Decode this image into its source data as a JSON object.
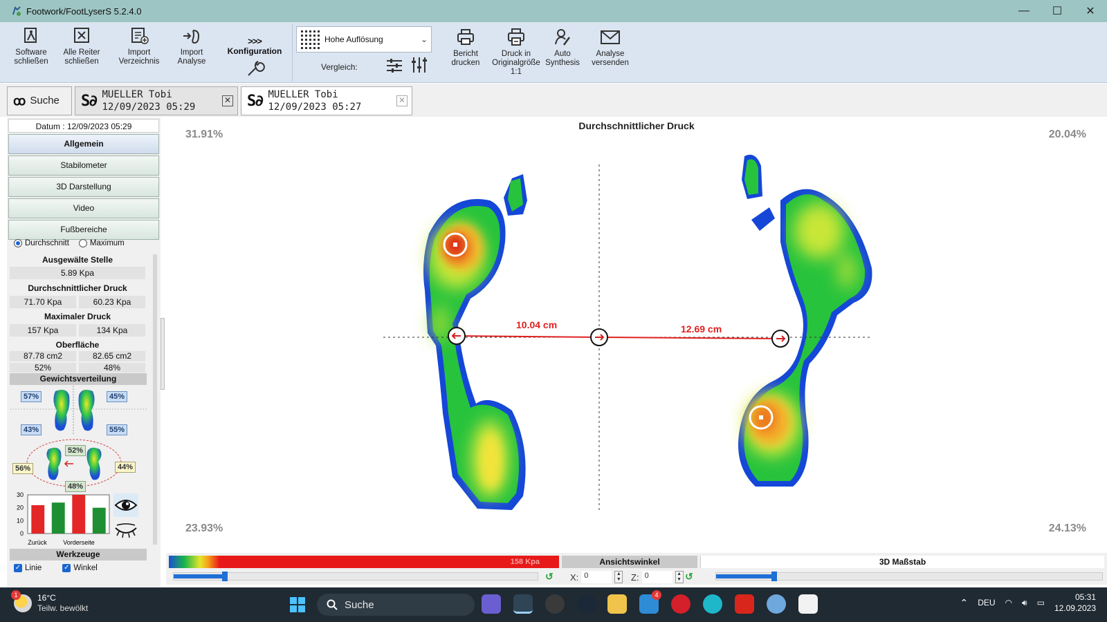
{
  "window": {
    "title": "Footwork/FootLyserS 5.2.4.0",
    "minimize": "—",
    "maximize": "☐",
    "close": "✕"
  },
  "ribbon": {
    "software_schliessen": "Software\nschließen",
    "alle_reiter_schliessen": "Alle Reiter\nschließen",
    "import_verzeichnis": "Import\nVerzeichnis",
    "import_analyse": "Import\nAnalyse",
    "konfiguration_arrows": ">>>",
    "konfiguration": "Konfiguration",
    "resolution_value": "Hohe Auflösung",
    "vergleich": "Vergleich:",
    "bericht_drucken": "Bericht\ndrucken",
    "druck_original": "Druck in\nOriginalgröße\n1:1",
    "auto_synthesis": "Auto\nSynthesis",
    "analyse_versenden": "Analyse\nversenden"
  },
  "tabs": {
    "search_label": "Suche",
    "tab1": {
      "name": "MUELLER Tobi",
      "date": "12/09/2023 05:29"
    },
    "tab2": {
      "name": "MUELLER Tobi",
      "date": "12/09/2023 05:27"
    }
  },
  "left": {
    "datum": "Datum : 12/09/2023 05:29",
    "nav": [
      "Allgemein",
      "Stabilometer",
      "3D Darstellung",
      "Video",
      "Fußbereiche"
    ],
    "radio_avg": "Durchschnitt",
    "radio_max": "Maximum",
    "ausgewaehlte_stelle": "Ausgewälte Stelle",
    "stelle_value": "5.89 Kpa",
    "durchschn_druck": "Durchschnittlicher Druck",
    "durchschn_left": "71.70 Kpa",
    "durchschn_right": "60.23 Kpa",
    "max_druck": "Maximaler Druck",
    "max_left": "157 Kpa",
    "max_right": "134 Kpa",
    "oberflaeche": "Oberfläche",
    "ober_left": "87.78 cm2",
    "ober_right": "82.65 cm2",
    "ober_pct_left": "52%",
    "ober_pct_right": "48%",
    "gewichtsverteilung": "Gewichtsverteilung",
    "gw": {
      "top_left": "57%",
      "top_right": "45%",
      "bottom_left": "43%",
      "bottom_right": "55%",
      "center_top": "52%",
      "center_bottom": "48%",
      "side_left": "56%",
      "side_right": "44%"
    },
    "bar_chart": {
      "y_ticks": [
        "30",
        "20",
        "10",
        "0"
      ],
      "x_labels": [
        "Zurück",
        "Vorderseite"
      ],
      "values": [
        22,
        24,
        30,
        20
      ],
      "colors": [
        "#e32626",
        "#1e8f32",
        "#e32626",
        "#1e8f32"
      ],
      "ylim": [
        0,
        30
      ]
    },
    "werkzeuge": "Werkzeuge",
    "chk_linie": "Linie",
    "chk_winkel": "Winkel"
  },
  "canvas": {
    "title": "Durchschnittlicher Druck",
    "pct_tl": "31.91%",
    "pct_tr": "20.04%",
    "pct_bl": "23.93%",
    "pct_br": "24.13%",
    "dist_left": "10.04 cm",
    "dist_right": "12.69 cm"
  },
  "bottom": {
    "scale_max": "158 Kpa",
    "ansichtswinkel": "Ansichtswinkel",
    "massstab": "3D Maßstab",
    "x_label": "X:",
    "x_value": "0",
    "z_label": "Z:",
    "z_value": "0",
    "scale_slider_level": 0.14,
    "massstab_slider_level": 0.15
  },
  "taskbar": {
    "temp": "16°C",
    "weather": "Teilw. bewölkt",
    "weather_badge": "1",
    "search": "Suche",
    "lang": "DEU",
    "time": "05:31",
    "date": "12.09.2023",
    "mail_badge": "4"
  }
}
